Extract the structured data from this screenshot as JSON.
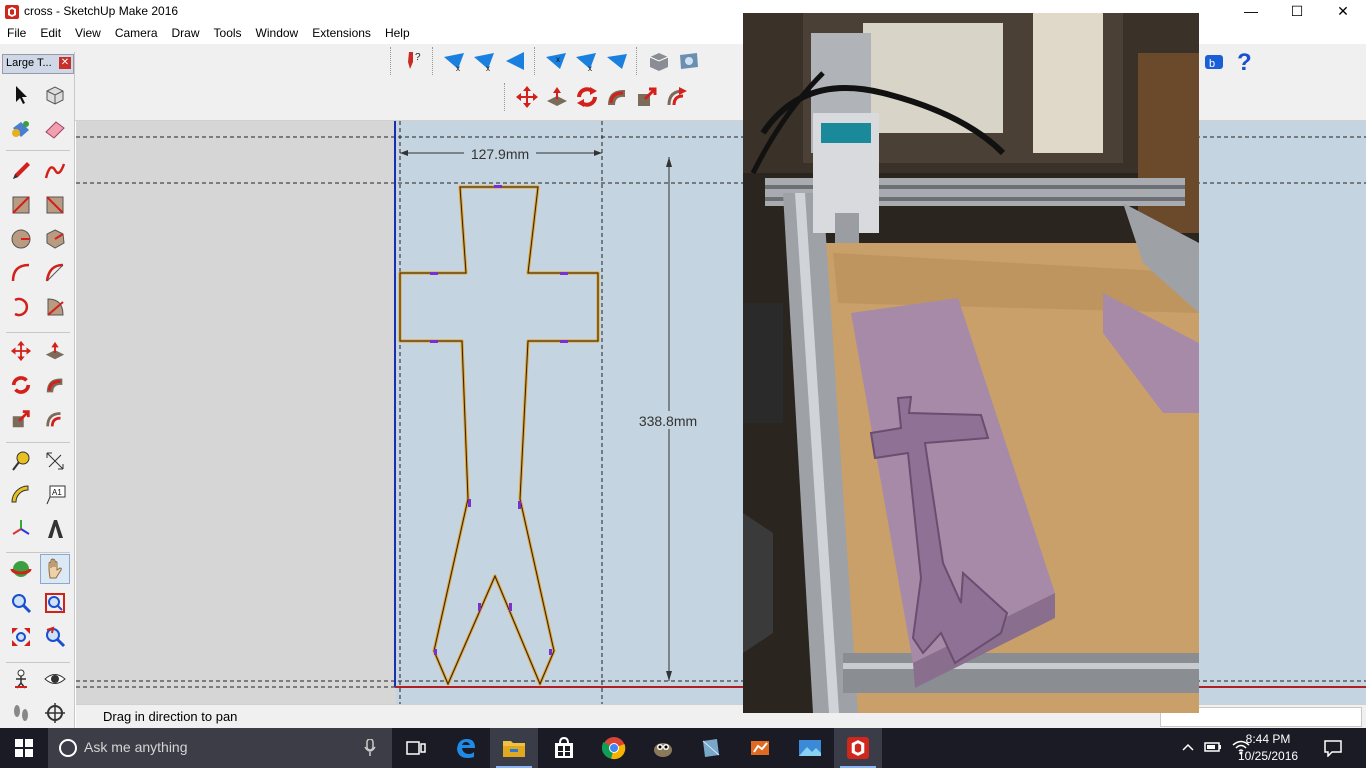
{
  "window": {
    "title": "cross - SketchUp Make 2016",
    "controls": {
      "minimize": "—",
      "maximize": "☐",
      "close": "✕"
    }
  },
  "menu": [
    "File",
    "Edit",
    "View",
    "Camera",
    "Draw",
    "Tools",
    "Window",
    "Extensions",
    "Help"
  ],
  "tray": {
    "title": "Large T...",
    "close": "✕"
  },
  "tools": [
    "select-icon",
    "component-icon",
    "paint-bucket-icon",
    "eraser-icon",
    "pencil-icon",
    "freehand-icon",
    "rectangle-icon",
    "rotated-rectangle-icon",
    "circle-icon",
    "polygon-icon",
    "arc-icon",
    "two-point-arc-icon",
    "three-point-arc-icon",
    "pie-icon",
    "move-icon",
    "push-pull-icon",
    "rotate-icon",
    "follow-me-icon",
    "scale-icon",
    "offset-icon",
    "tape-measure-icon",
    "dimension-icon",
    "protractor-icon",
    "text-icon",
    "axes-icon",
    "3d-text-icon",
    "orbit-icon",
    "pan-icon",
    "zoom-icon",
    "zoom-window-icon",
    "zoom-extents-icon",
    "previous-view-icon",
    "position-camera-icon",
    "look-around-icon",
    "walk-icon",
    "section-plane-icon"
  ],
  "drawing": {
    "width_dimension": "127.9mm",
    "height_dimension": "338.8mm"
  },
  "status": {
    "message": "Drag in direction to pan",
    "measurement_value": ""
  },
  "taskbar": {
    "search_placeholder": "Ask me anything",
    "time": "8:44 PM",
    "date": "10/25/2016"
  },
  "colors": {
    "viewport": "#c4d4e0",
    "outline": "#e8a020",
    "taskbar": "#1a1b25",
    "foam": "#a68aa8"
  }
}
